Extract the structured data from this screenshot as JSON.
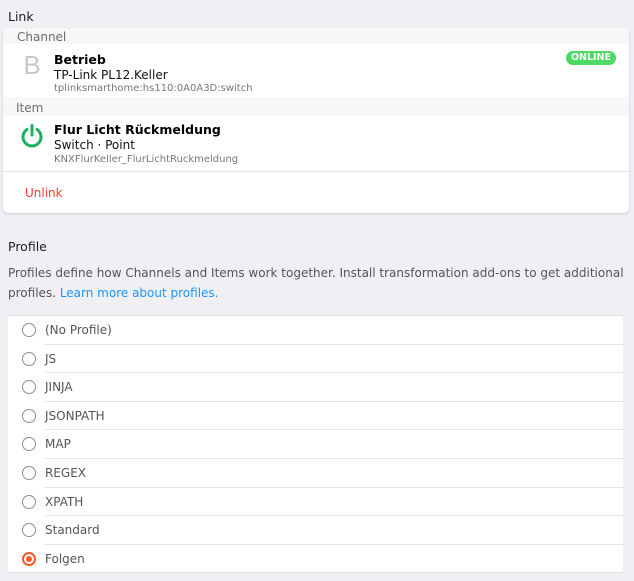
{
  "link_section": {
    "title": "Link",
    "channel_label": "Channel",
    "item_label": "Item",
    "channel": {
      "icon_letter": "B",
      "name": "Betrieb",
      "thing": "TP-Link PL12.Keller",
      "uid": "tplinksmarthome:hs110:0A0A3D:switch",
      "status": "ONLINE",
      "status_color": "#4cd964"
    },
    "item": {
      "icon": "power-icon",
      "icon_color": "#1fae5b",
      "label": "Flur Licht Rückmeldung",
      "type": "Switch · Point",
      "name": "KNXFlurKeller_FlurLichtRuckmeldung"
    },
    "unlink_label": "Unlink"
  },
  "profile_section": {
    "title": "Profile",
    "description": "Profiles define how Channels and Items work together. Install transformation add-ons to get additional profiles.",
    "learn_more": "Learn more about profiles.",
    "options": [
      {
        "label": "(No Profile)",
        "checked": false
      },
      {
        "label": "JS",
        "checked": false
      },
      {
        "label": "JINJA",
        "checked": false
      },
      {
        "label": "JSONPATH",
        "checked": false
      },
      {
        "label": "MAP",
        "checked": false
      },
      {
        "label": "REGEX",
        "checked": false
      },
      {
        "label": "XPATH",
        "checked": false
      },
      {
        "label": "Standard",
        "checked": false
      },
      {
        "label": "Folgen",
        "checked": true
      }
    ],
    "accent_color": "#ff5722"
  }
}
